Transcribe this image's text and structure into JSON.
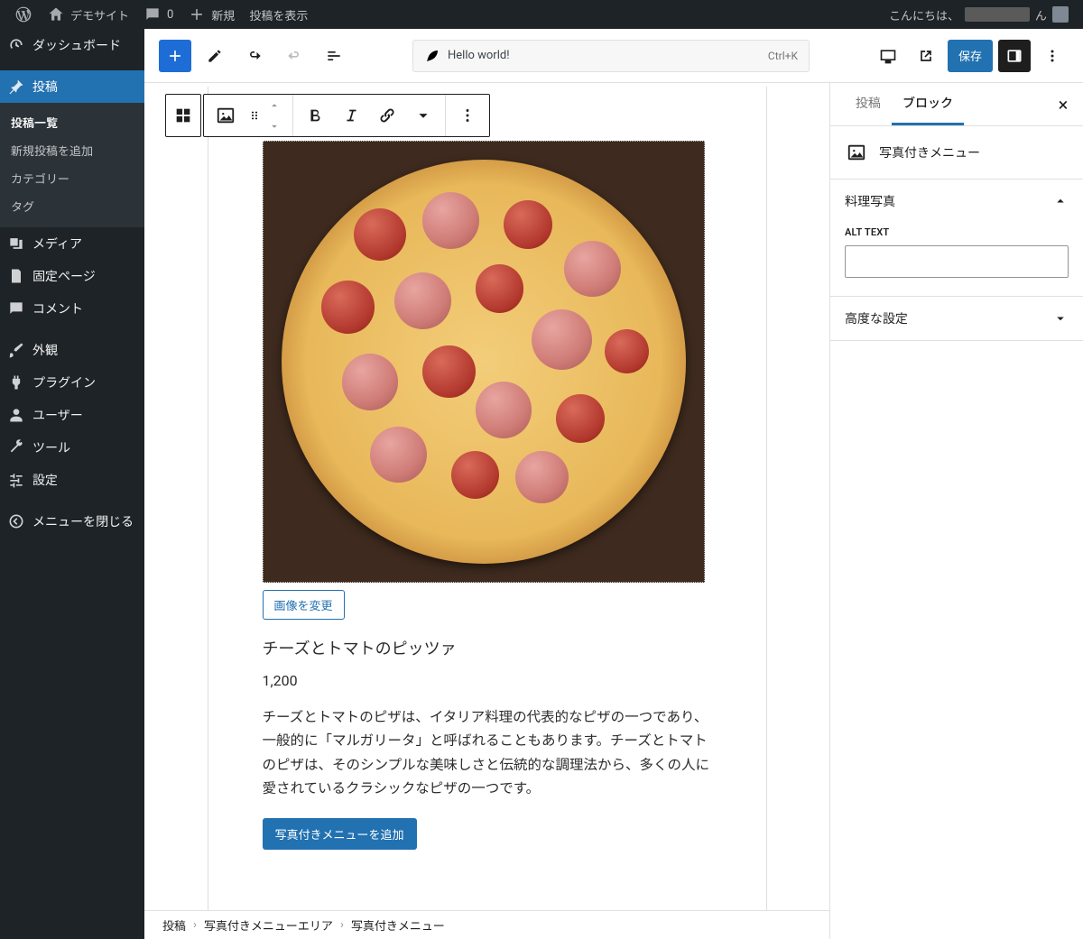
{
  "adminbar": {
    "site_name": "デモサイト",
    "comments_count": "0",
    "new_label": "新規",
    "view_post": "投稿を表示",
    "greeting_prefix": "こんにちは、",
    "greeting_suffix": "ん"
  },
  "sidebar": {
    "dashboard": "ダッシュボード",
    "posts": "投稿",
    "submenu": {
      "all_posts": "投稿一覧",
      "add_new": "新規投稿を追加",
      "categories": "カテゴリー",
      "tags": "タグ"
    },
    "media": "メディア",
    "pages": "固定ページ",
    "comments": "コメント",
    "appearance": "外観",
    "plugins": "プラグイン",
    "users": "ユーザー",
    "tools": "ツール",
    "settings": "設定",
    "collapse": "メニューを閉じる"
  },
  "topbar": {
    "doc_title": "Hello world!",
    "shortcut": "Ctrl+K",
    "save": "保存"
  },
  "content": {
    "change_image": "画像を変更",
    "item_title": "チーズとトマトのピッツァ",
    "item_price": "1,200",
    "item_desc": "チーズとトマトのピザは、イタリア料理の代表的なピザの一つであり、一般的に「マルガリータ」と呼ばれることもあります。チーズとトマトのピザは、そのシンプルな美味しさと伝統的な調理法から、多くの人に愛されているクラシックなピザの一つです。",
    "add_menu": "写真付きメニューを追加"
  },
  "breadcrumb": {
    "a": "投稿",
    "b": "写真付きメニューエリア",
    "c": "写真付きメニュー"
  },
  "inspector": {
    "tab_post": "投稿",
    "tab_block": "ブロック",
    "block_name": "写真付きメニュー",
    "panel_photo": "料理写真",
    "alt_label": "ALT TEXT",
    "panel_advanced": "高度な設定"
  }
}
